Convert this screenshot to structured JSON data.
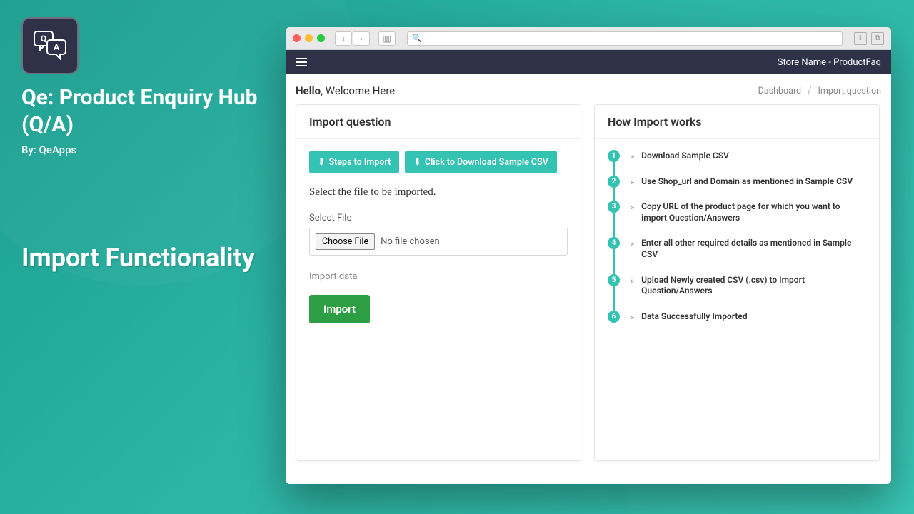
{
  "promo": {
    "title": "Qe: Product Enquiry Hub (Q/A)",
    "by": "By: QeApps",
    "heading": "Import Functionality"
  },
  "topbar": {
    "store": "Store Name - ProductFaq"
  },
  "greeting": {
    "hello": "Hello",
    "welcome": ", Welcome Here"
  },
  "breadcrumb": {
    "a": "Dashboard",
    "b": "Import question"
  },
  "left": {
    "title": "Import question",
    "stepsBtn": "Steps to Import",
    "downloadBtn": "Click to Download Sample CSV",
    "selectHead": "Select the file to be imported.",
    "selectLabel": "Select File",
    "chooseBtn": "Choose File",
    "noFile": "No file chosen",
    "helper": "Import data",
    "importBtn": "Import"
  },
  "right": {
    "title": "How Import works",
    "steps": [
      "Download Sample CSV",
      "Use Shop_url and Domain as mentioned in Sample CSV",
      "Copy URL of the product page for which you want to import Question/Answers",
      "Enter all other required details as mentioned in Sample CSV",
      "Upload Newly created CSV (.csv) to Import Question/Answers",
      "Data Successfully Imported"
    ]
  }
}
